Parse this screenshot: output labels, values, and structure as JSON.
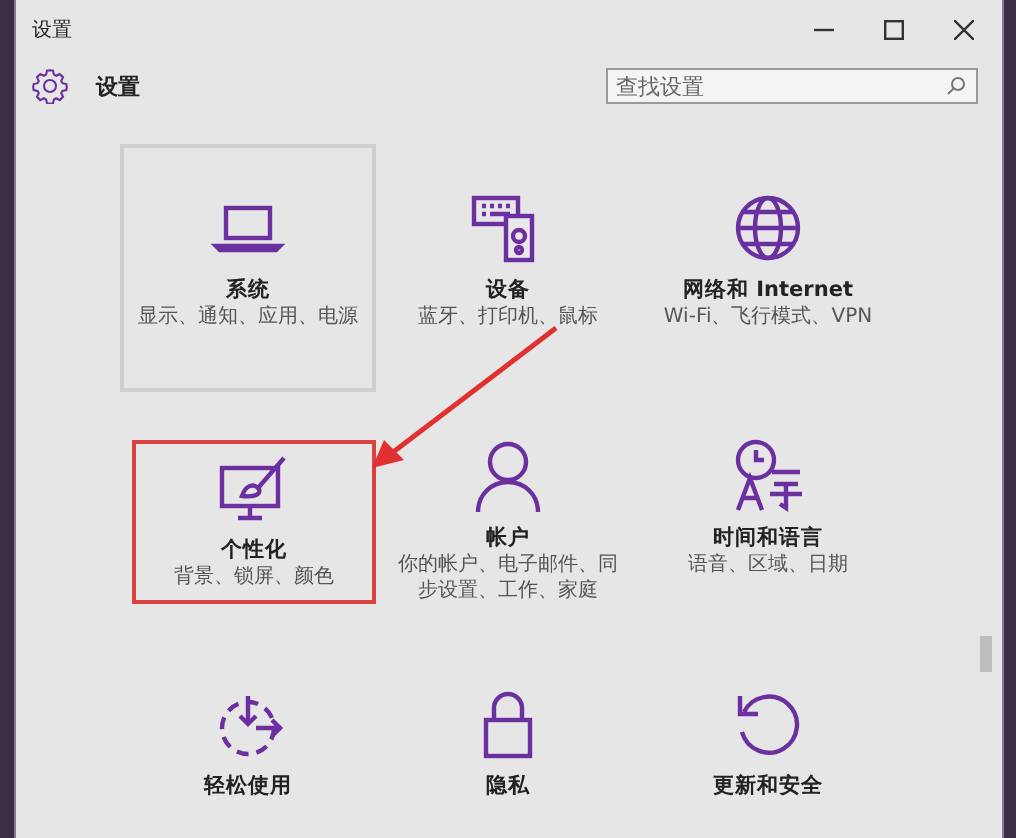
{
  "window": {
    "title": "设置"
  },
  "header": {
    "title": "设置"
  },
  "search": {
    "placeholder": "查找设置"
  },
  "tiles": [
    {
      "kind": "laptop",
      "title": "系统",
      "description": "显示、通知、应用、电源",
      "hovered": true,
      "annotated": false
    },
    {
      "kind": "devices",
      "title": "设备",
      "description": "蓝牙、打印机、鼠标",
      "hovered": false,
      "annotated": false
    },
    {
      "kind": "globe",
      "title": "网络和 Internet",
      "description": "Wi-Fi、飞行模式、VPN",
      "hovered": false,
      "annotated": false
    },
    {
      "kind": "paint",
      "title": "个性化",
      "description": "背景、锁屏、颜色",
      "hovered": false,
      "annotated": true
    },
    {
      "kind": "person",
      "title": "帐户",
      "description": "你的帐户、电子邮件、同步设置、工作、家庭",
      "hovered": false,
      "annotated": false
    },
    {
      "kind": "clock",
      "title": "时间和语言",
      "description": "语音、区域、日期",
      "hovered": false,
      "annotated": false
    },
    {
      "kind": "ease",
      "title": "轻松使用",
      "hovered": false,
      "annotated": false
    },
    {
      "kind": "lock",
      "title": "隐私",
      "hovered": false,
      "annotated": false
    },
    {
      "kind": "update",
      "title": "更新和安全",
      "hovered": false,
      "annotated": false
    }
  ]
}
